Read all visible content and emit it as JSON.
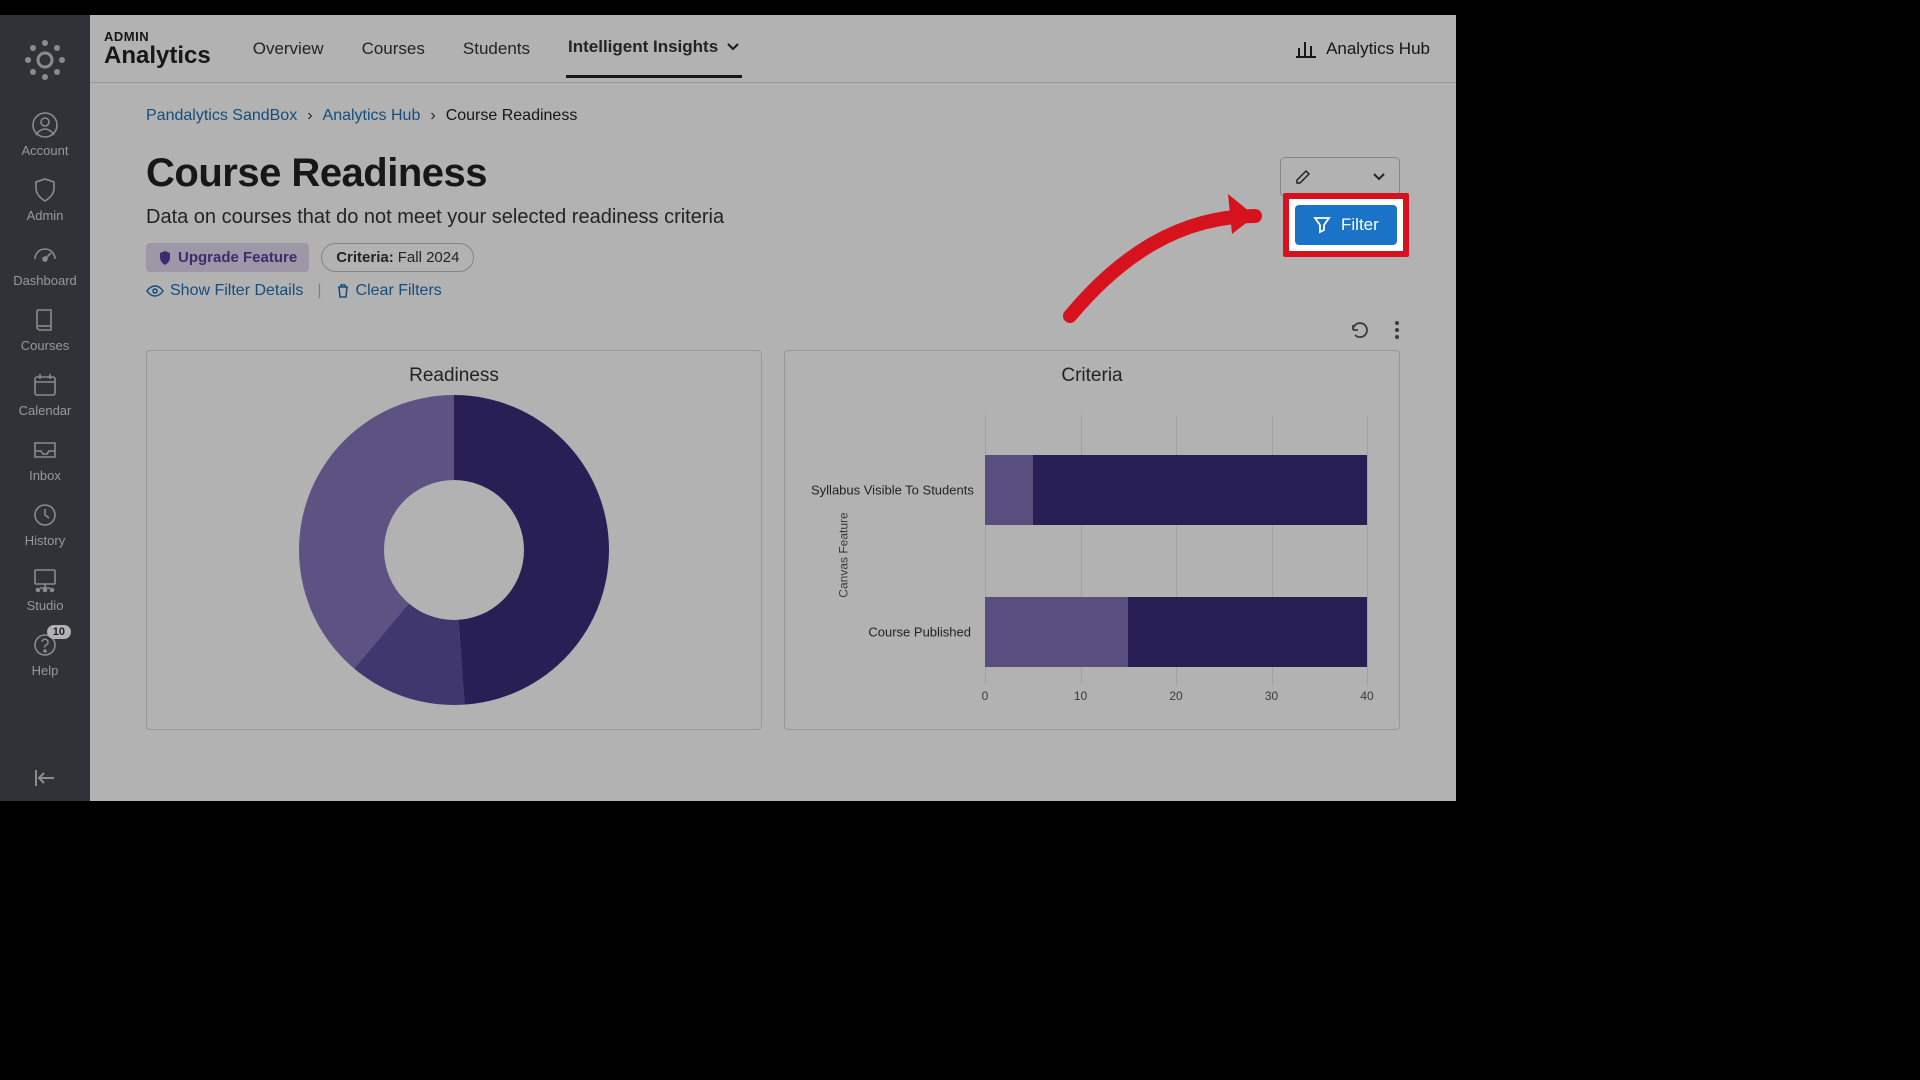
{
  "rail": {
    "items": [
      {
        "label": "Account"
      },
      {
        "label": "Admin"
      },
      {
        "label": "Dashboard"
      },
      {
        "label": "Courses"
      },
      {
        "label": "Calendar"
      },
      {
        "label": "Inbox"
      },
      {
        "label": "History"
      },
      {
        "label": "Studio"
      },
      {
        "label": "Help",
        "badge": "10"
      }
    ]
  },
  "header": {
    "brand_small": "ADMIN",
    "brand_big": "Analytics",
    "tabs": [
      "Overview",
      "Courses",
      "Students",
      "Intelligent Insights"
    ],
    "active_tab": 3,
    "hub_link": "Analytics Hub"
  },
  "breadcrumb": [
    {
      "text": "Pandalytics SandBox",
      "link": true
    },
    {
      "text": "Analytics Hub",
      "link": true
    },
    {
      "text": "Course Readiness",
      "link": false
    }
  ],
  "page": {
    "title": "Course Readiness",
    "subtitle": "Data on courses that do not meet your selected readiness criteria",
    "upgrade_chip": "Upgrade Feature",
    "criteria_chip": {
      "label": "Criteria:",
      "value": "Fall 2024"
    },
    "show_filter_details": "Show Filter Details",
    "clear_filters": "Clear Filters",
    "filter_button": "Filter"
  },
  "cards": {
    "readiness_title": "Readiness",
    "criteria_title": "Criteria"
  },
  "chart_data": [
    {
      "type": "pie",
      "title": "Readiness",
      "series": [
        {
          "name": "segment-a",
          "value": 49,
          "color": "#3a2e7a"
        },
        {
          "name": "segment-b",
          "value": 12,
          "color": "#5c4fa0"
        },
        {
          "name": "segment-c",
          "value": 39,
          "color": "#8478bc"
        }
      ]
    },
    {
      "type": "bar",
      "title": "Criteria",
      "orientation": "horizontal",
      "ylabel": "Canvas Feature",
      "xlim": [
        0,
        40
      ],
      "xticks": [
        0,
        10,
        20,
        30,
        40
      ],
      "categories": [
        "Syllabus Visible To Students",
        "Course Published"
      ],
      "series": [
        {
          "name": "series-a",
          "color": "#8071b5",
          "values": [
            5,
            15
          ]
        },
        {
          "name": "series-b",
          "color": "#3a2e7a",
          "values": [
            35,
            25
          ]
        }
      ]
    }
  ]
}
